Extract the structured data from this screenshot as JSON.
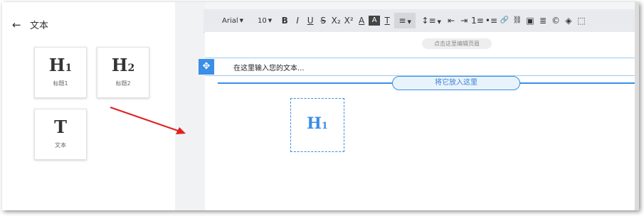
{
  "panel": {
    "back_icon": "←",
    "title": "文本",
    "tiles": [
      {
        "glyph": "H",
        "sub": "1",
        "label": "标题1"
      },
      {
        "glyph": "H",
        "sub": "2",
        "label": "标题2"
      },
      {
        "glyph": "T",
        "sub": "",
        "label": "文本"
      }
    ]
  },
  "toolbar": {
    "font": "Arial",
    "size": "10",
    "buttons": [
      "B",
      "I",
      "U",
      "S",
      "X₂",
      "X²",
      "A",
      "A",
      "T",
      "≡",
      "↕≡",
      "⇤",
      "⇥",
      "1≡",
      "•≡",
      "🔗",
      "⛓",
      "▣",
      "≣",
      "©",
      "◈",
      "⬚"
    ]
  },
  "canvas": {
    "edit_header": "点击这里编辑页眉",
    "move_icon": "✥",
    "text_placeholder": "在这里输入您的文本...",
    "drop_label": "将它放入这里",
    "ghost_glyph": "H",
    "ghost_sub": "1"
  },
  "colors": {
    "accent": "#3a8ee6",
    "arrow": "#e02020"
  }
}
